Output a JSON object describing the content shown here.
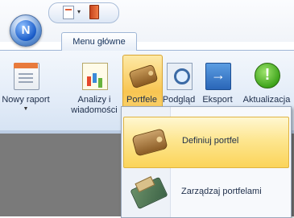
{
  "app": {
    "orb_letter": "N"
  },
  "tabs": [
    {
      "label": "Menu główne",
      "active": true
    }
  ],
  "ribbon": {
    "buttons": [
      {
        "label": "Nowy raport",
        "icon": "new-report-icon",
        "has_dropdown": true
      },
      {
        "label": "Analizy i wiadomości",
        "label_line1": "Analizy i",
        "label_line2": "wiadomości",
        "icon": "analysis-icon",
        "has_dropdown": false
      },
      {
        "label": "Portfele",
        "icon": "wallet-icon",
        "has_dropdown": true,
        "highlighted": true
      },
      {
        "label": "Podgląd",
        "icon": "preview-icon",
        "has_dropdown": false
      },
      {
        "label": "Eksport",
        "icon": "export-icon",
        "has_dropdown": true
      },
      {
        "label": "Aktualizacja",
        "icon": "update-icon",
        "has_dropdown": false
      }
    ]
  },
  "dropdown": {
    "items": [
      {
        "label": "Definiuj portfel",
        "icon": "wallet-icon",
        "highlighted": true
      },
      {
        "label": "Zarządzaj portfelami",
        "icon": "open-wallet-icon",
        "highlighted": false
      }
    ]
  },
  "colors": {
    "accent_highlight": "#fbd45a",
    "ribbon_bg": "#e3ecf8",
    "dark_area": "#7a7a7a"
  }
}
